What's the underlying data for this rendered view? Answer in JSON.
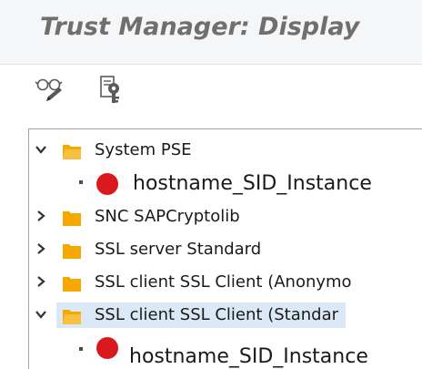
{
  "window": {
    "title": "Trust Manager: Display"
  },
  "toolbar": {
    "buttons": [
      {
        "name": "display-toggle",
        "icon": "glasses-pencil-icon"
      },
      {
        "name": "key-certificate",
        "icon": "key-certificate-icon"
      }
    ]
  },
  "tree": {
    "nodes": [
      {
        "label": "System PSE",
        "expanded": true,
        "type": "folder"
      },
      {
        "label": "hostname_SID_Instance",
        "type": "pse-entry",
        "status_color": "#d9191e"
      },
      {
        "label": "SNC SAPCryptolib",
        "expanded": false,
        "type": "folder"
      },
      {
        "label": "SSL server Standard",
        "expanded": false,
        "type": "folder"
      },
      {
        "label": "SSL client SSL Client (Anonymo",
        "expanded": false,
        "type": "folder"
      },
      {
        "label": "SSL client SSL Client (Standar",
        "expanded": true,
        "type": "folder",
        "selected": true
      },
      {
        "label": "hostname_SID_Instance",
        "type": "pse-entry",
        "status_color": "#d9191e"
      }
    ]
  },
  "colors": {
    "folder": "#f5a800",
    "selection": "#dbe9f6",
    "status_red": "#d9191e"
  }
}
